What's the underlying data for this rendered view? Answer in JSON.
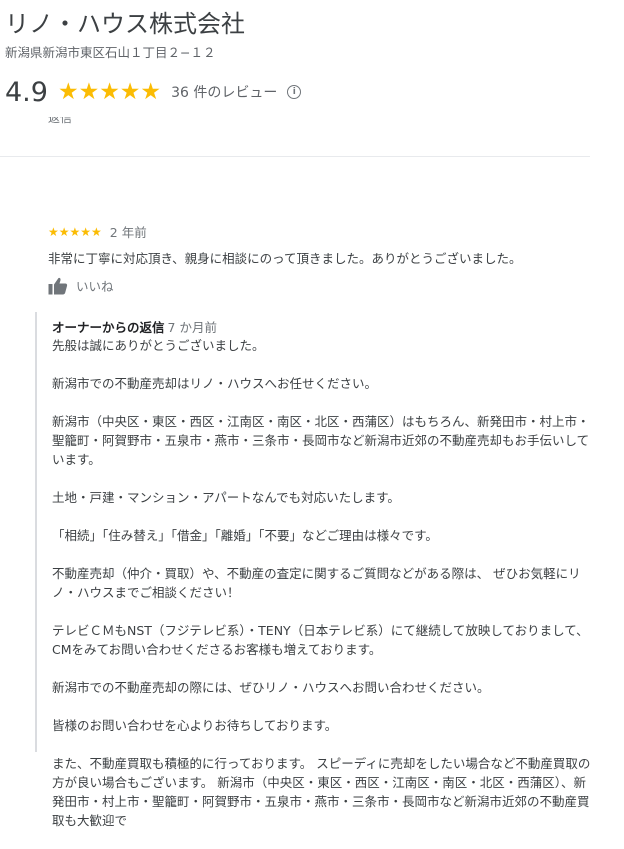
{
  "business": {
    "name": "リノ・ハウス株式会社",
    "address": "新潟県新潟市東区石山１丁目２−１２",
    "rating": "4.9",
    "stars": "★★★★★",
    "review_count": "36 件のレビュー",
    "info_icon": "info-icon"
  },
  "clipped_previous": "返信",
  "review": {
    "stars": "★★★★★",
    "date": "2 年前",
    "text": "非常に丁寧に対応頂き、親身に相談にのって頂きました。ありがとうございました。",
    "like_label": "いいね",
    "like_icon": "thumbs-up-icon"
  },
  "owner_reply": {
    "title": "オーナーからの返信",
    "date": "7 か月前",
    "paragraphs": [
      "先般は誠にありがとうございました。",
      "新潟市での不動産売却はリノ・ハウスへお任せください。",
      "新潟市（中央区・東区・西区・江南区・南区・北区・西蒲区）はもちろん、新発田市・村上市・聖籠町・阿賀野市・五泉市・燕市・三条市・長岡市など新潟市近郊の不動産売却もお手伝いしています。",
      "土地・戸建・マンション・アパートなんでも対応いたします。",
      "「相続」「住み替え」「借金」「離婚」「不要」などご理由は様々です。",
      "不動産売却（仲介・買取）や、不動産の査定に関するご質問などがある際は、 ぜひお気軽にリノ・ハウスまでご相談ください！",
      "テレビＣＭもNST（フジテレビ系）・TENY（日本テレビ系）にて継続して放映しておりまして、CMをみてお問い合わせくださるお客様も増えております。",
      "新潟市での不動産売却の際には、ぜひリノ・ハウスへお問い合わせください。",
      "皆様のお問い合わせを心よりお待ちしております。",
      "また、不動産買取も積極的に行っております。 スピーディに売却をしたい場合など不動産買取の方が良い場合もございます。 新潟市（中央区・東区・西区・江南区・南区・北区・西蒲区）、新発田市・村上市・聖籠町・阿賀野市・五泉市・燕市・三条市・長岡市など新潟市近郊の不動産買取も大歓迎で"
    ]
  }
}
